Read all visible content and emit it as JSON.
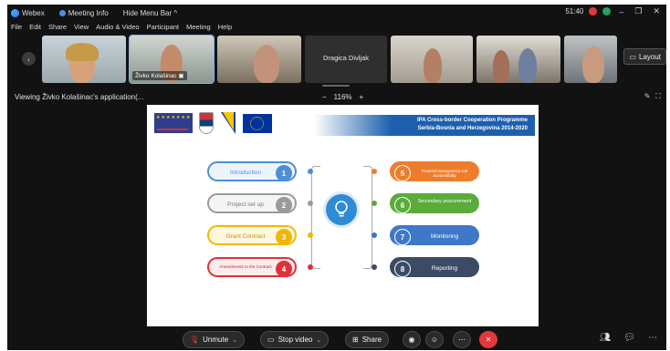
{
  "titlebar": {
    "app_name": "Webex",
    "meeting_info": "Meeting Info",
    "hide_menu_bar": "Hide Menu Bar ^",
    "timer": "51:40"
  },
  "menu": [
    "File",
    "Edit",
    "Share",
    "View",
    "Audio & Video",
    "Participant",
    "Meeting",
    "Help"
  ],
  "participants": {
    "tile2_name": "Živko Kolašinac",
    "tile4_name": "Dragica Divljak"
  },
  "layout_button": "Layout",
  "share_header": {
    "viewing": "Viewing Živko Kolašinac's application(...",
    "zoom_minus": "−",
    "zoom_value": "116%",
    "zoom_plus": "+"
  },
  "slide": {
    "banner_line1": "IPA Cross-border Cooperation Programme",
    "banner_line2": "Serbia-Bosnia and Herzegovina 2014-2020",
    "left_steps": [
      {
        "n": "1",
        "label": "Introduction"
      },
      {
        "n": "2",
        "label": "Project set up"
      },
      {
        "n": "3",
        "label": "Grant Contract"
      },
      {
        "n": "4",
        "label": "Amendments to the Contract"
      }
    ],
    "right_steps": [
      {
        "n": "5",
        "label": "Financial management and accountability"
      },
      {
        "n": "6",
        "label": "Secondary procurement"
      },
      {
        "n": "7",
        "label": "Monitoring"
      },
      {
        "n": "8",
        "label": "Reporting"
      }
    ]
  },
  "controls": {
    "unmute": "Unmute",
    "stop_video": "Stop video",
    "share": "Share"
  },
  "colors": {
    "step1": "#4a8fd8",
    "step2": "#9a9a9a",
    "step3": "#f2b705",
    "step4": "#e0313a",
    "step5": "#ee7d2b",
    "step6": "#5aab3a",
    "step7": "#3f77c9",
    "step8": "#3c4a66",
    "leave": "#e3383b"
  }
}
